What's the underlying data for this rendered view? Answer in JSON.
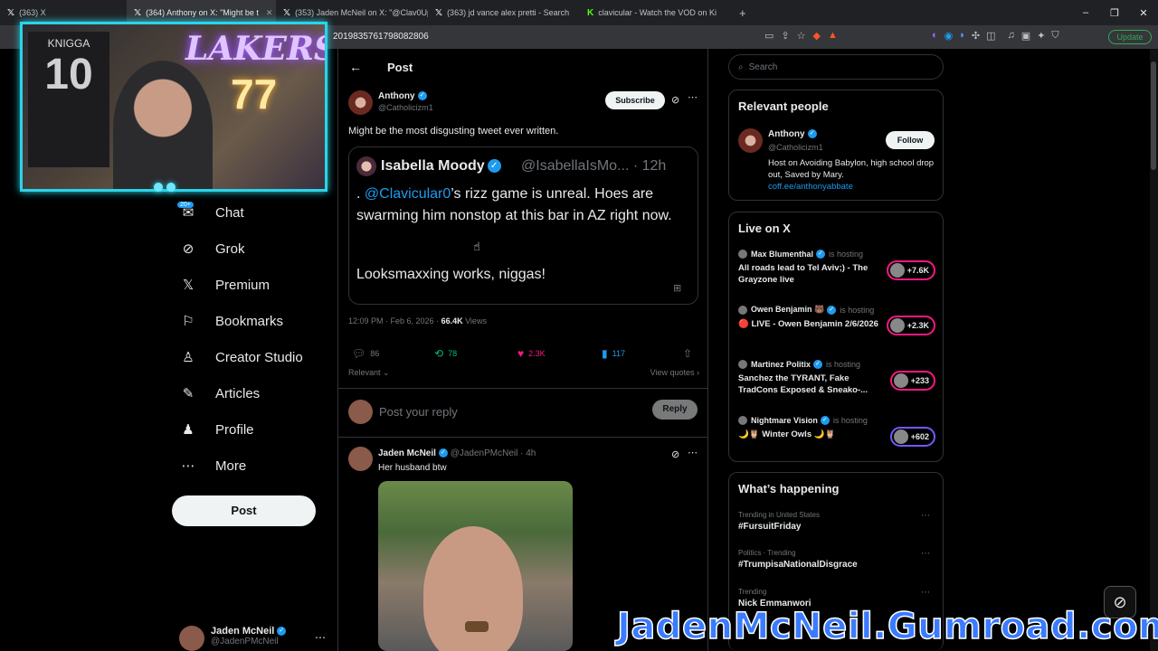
{
  "browser": {
    "tabs": [
      {
        "label": "(363) X",
        "icon": "x-logo",
        "active": false
      },
      {
        "label": "(364) Anthony on X: \"Might be t",
        "icon": "x-logo",
        "active": true
      },
      {
        "label": "(353) Jaden McNeil on X: \"@Clav0Up",
        "icon": "x-logo",
        "active": false
      },
      {
        "label": "(363) jd vance alex pretti - Search",
        "icon": "x-logo",
        "active": false
      },
      {
        "label": "clavicular - Watch the VOD on Ki",
        "icon": "kick-logo",
        "active": false
      }
    ],
    "url": "2019835761798082806",
    "update_label": "Update"
  },
  "sidebar": {
    "chat_badge": "20+",
    "items": [
      {
        "label": "Chat",
        "icon": "chat-icon"
      },
      {
        "label": "Grok",
        "icon": "grok-icon"
      },
      {
        "label": "Premium",
        "icon": "x-logo-icon"
      },
      {
        "label": "Bookmarks",
        "icon": "bookmark-icon"
      },
      {
        "label": "Creator Studio",
        "icon": "creator-studio-icon"
      },
      {
        "label": "Articles",
        "icon": "articles-icon"
      },
      {
        "label": "Profile",
        "icon": "profile-icon"
      },
      {
        "label": "More",
        "icon": "more-icon"
      }
    ],
    "post_label": "Post",
    "account": {
      "name": "Jaden McNeil",
      "handle": "@JadenPMcNeil"
    }
  },
  "main": {
    "header_title": "Post",
    "post": {
      "author_name": "Anthony",
      "author_handle": "@Catholicizm1",
      "subscribe_label": "Subscribe",
      "text": "Might be the most disgusting tweet ever written.",
      "quote": {
        "name": "Isabella Moody",
        "handle": "@IsabellaIsMo... · 12h",
        "body_prefix": ". ",
        "mention": "@Clavicular0",
        "body_rest": "’s rizz game is unreal. Hoes are swarming him nonstop at this bar in AZ right now.",
        "line2": "Looksmaxxing works, niggas!"
      },
      "timestamp": "12:09 PM · Feb 6, 2026 · ",
      "views_count": "66.4K",
      "views_label": " Views",
      "replies": "86",
      "reposts": "78",
      "likes": "2.3K",
      "bookmarks": "117",
      "sort_label": "Relevant",
      "view_quotes_label": "View quotes"
    },
    "reply_placeholder": "Post your reply",
    "reply_button": "Reply",
    "reply_tweet": {
      "name": "Jaden McNeil",
      "handle_time": "@JadenPMcNeil · 4h",
      "text": "Her husband btw"
    }
  },
  "right": {
    "search_placeholder": "Search",
    "relevant": {
      "title": "Relevant people",
      "name": "Anthony",
      "handle": "@Catholicizm1",
      "follow_label": "Follow",
      "bio": "Host on Avoiding Babylon, high school drop out, Saved by Mary.",
      "link": "coff.ee/anthonyabbate"
    },
    "live": {
      "title": "Live on X",
      "hosting_label": "is hosting",
      "items": [
        {
          "host": "Max Blumenthal",
          "title": "All roads lead to Tel Aviv;) - The Grayzone live",
          "count": "+7.6K"
        },
        {
          "host": "Owen Benjamin 🐻",
          "title": "🔴 LIVE - Owen Benjamin 2/6/2026",
          "count": "+2.3K"
        },
        {
          "host": "Martinez Politix",
          "title": "Sanchez the TYRANT, Fake TradCons Exposed & Sneako-...",
          "count": "+233"
        },
        {
          "host": "Nightmare Vision",
          "title": "🌙🦉 Winter Owls 🌙🦉",
          "count": "+602"
        }
      ]
    },
    "happening": {
      "title": "What’s happening",
      "trends": [
        {
          "category": "Trending in United States",
          "tag": "#FursuitFriday"
        },
        {
          "category": "Politics · Trending",
          "tag": "#TrumpisaNationalDisgrace"
        },
        {
          "category": "Trending",
          "tag": "Nick Emmanwori"
        }
      ]
    }
  },
  "overlay": {
    "watermark": "JadenMcNeil.Gumroad.com",
    "webcam_jersey_name": "KNIGGA",
    "webcam_jersey_number": "10",
    "webcam_sign": "LAKERS"
  },
  "colors": {
    "accent": "#1d9bf0",
    "like": "#f91880",
    "repost": "#00ba7c",
    "webcam_border": "#2ad4e8",
    "watermark": "#3a7bff"
  }
}
